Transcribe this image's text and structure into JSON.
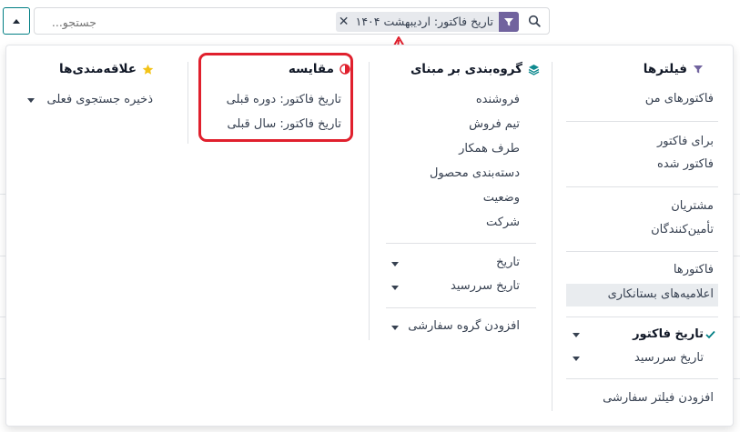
{
  "search": {
    "facet_label": "تاریخ فاکتور: اردیبهشت ۱۴۰۴",
    "placeholder": "جستجو...",
    "facet_color": "#71639e"
  },
  "filters": {
    "title": "فیلترها",
    "items": {
      "my_invoices": "فاکتورهای من",
      "to_invoice": "برای فاکتور",
      "invoiced": "فاکتور شده",
      "customers": "مشتریان",
      "vendors": "تأمین‌کنندگان",
      "invoices": "فاکتورها",
      "credit_notes": "اعلامیه‌های بستانکاری",
      "invoice_date": "تاریخ فاکتور",
      "due_date": "تاریخ سررسید",
      "add_custom": "افزودن فیلتر سفارشی"
    }
  },
  "groupby": {
    "title": "گروه‌بندی بر مبنای",
    "items": {
      "salesperson": "فروشنده",
      "sales_team": "تیم فروش",
      "partner": "طرف همکار",
      "product_category": "دسته‌بندی محصول",
      "status": "وضعیت",
      "company": "شرکت",
      "date": "تاریخ",
      "due_date": "تاریخ سررسید",
      "add_custom": "افزودن گروه سفارشی"
    }
  },
  "comparison": {
    "title": "مقایسه",
    "items": {
      "previous_period": "تاریخ فاکتور: دوره قبلی",
      "previous_year": "تاریخ فاکتور: سال قبلی"
    }
  },
  "favorites": {
    "title": "علاقه‌مندی‌ها",
    "save_search": "ذخیره جستجوی فعلی"
  },
  "colors": {
    "accent_purple": "#71639e",
    "teal": "#017e84",
    "annotation_red": "#e0202d",
    "star": "#f3c317",
    "selected_bg": "#e9ecef"
  }
}
